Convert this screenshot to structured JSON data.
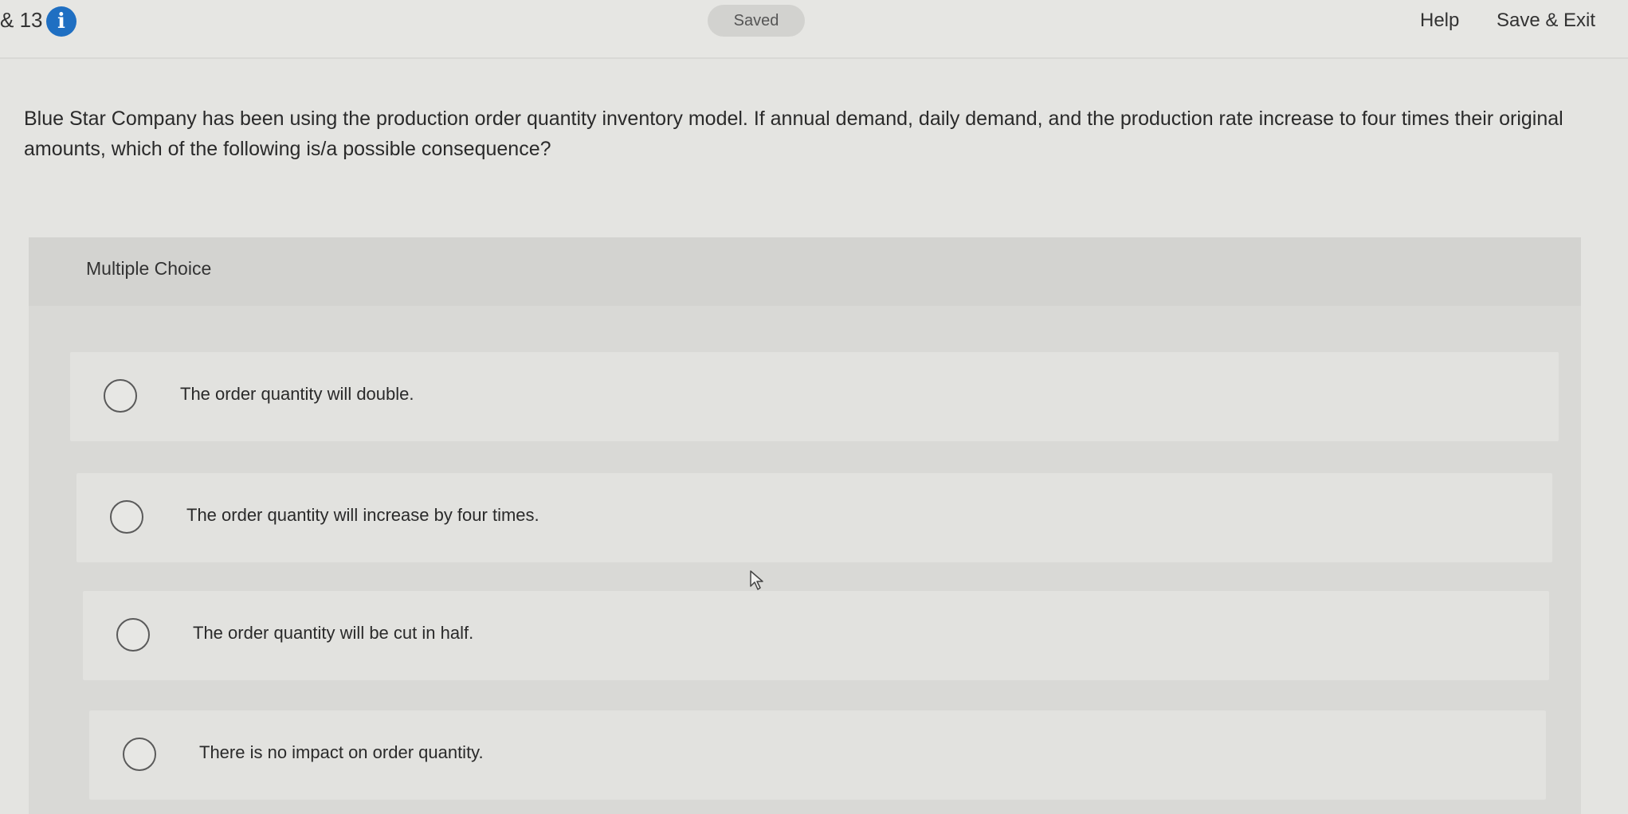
{
  "header": {
    "question_number": "& 13",
    "info_icon": "info-icon",
    "saved_label": "Saved",
    "help_label": "Help",
    "save_exit_label": "Save & Exit"
  },
  "question": {
    "text": "Blue Star Company has been using the production order quantity inventory model. If annual demand, daily demand, and the production rate increase to four times their original amounts, which of the following is/a possible consequence?"
  },
  "multiple_choice": {
    "label": "Multiple Choice",
    "options": [
      {
        "text": "The order quantity will double."
      },
      {
        "text": "The order quantity will increase by four times."
      },
      {
        "text": "The order quantity will be cut in half."
      },
      {
        "text": "There is no impact on order quantity."
      }
    ]
  },
  "colors": {
    "background": "#e4e4e1",
    "info_icon": "#1f6fc2",
    "panel": "#d9d9d6",
    "option_card": "#e2e2df"
  }
}
